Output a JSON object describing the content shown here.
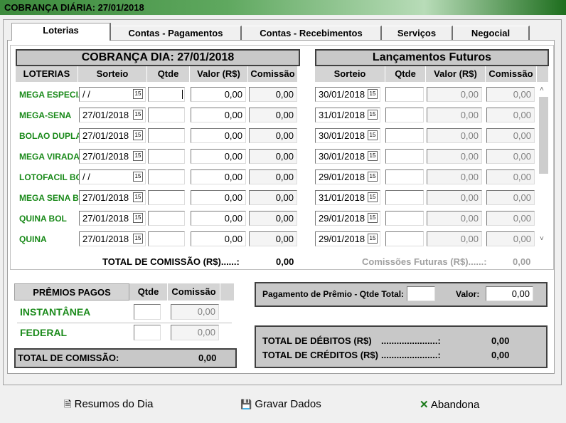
{
  "title": "COBRANÇA DIÁRIA: 27/01/2018",
  "tabs": [
    "Loterias",
    "Contas - Pagamentos",
    "Contas - Recebimentos",
    "Serviços",
    "Negocial"
  ],
  "left": {
    "title": "COBRANÇA DIA: 27/01/2018",
    "headers": [
      "LOTERIAS",
      "Sorteio",
      "Qtde",
      "Valor (R$)",
      "Comissão"
    ]
  },
  "right": {
    "title": "Lançamentos Futuros",
    "headers": [
      "Sorteio",
      "Qtde",
      "Valor (R$)",
      "Comissão"
    ]
  },
  "rows": [
    {
      "name": "MEGA  ESPECIAL",
      "sorteio": " /  /",
      "valor": "0,00",
      "comissao": "0,00",
      "fsorteio": "30/01/2018",
      "fvalor": "0,00",
      "fcomissao": "0,00"
    },
    {
      "name": "MEGA-SENA",
      "sorteio": "27/01/2018",
      "valor": "0,00",
      "comissao": "0,00",
      "fsorteio": "31/01/2018",
      "fvalor": "0,00",
      "fcomissao": "0,00"
    },
    {
      "name": "BOLAO DUPLA SENA",
      "sorteio": "27/01/2018",
      "valor": "0,00",
      "comissao": "0,00",
      "fsorteio": "30/01/2018",
      "fvalor": "0,00",
      "fcomissao": "0,00"
    },
    {
      "name": "MEGA VIRADA BOLAO",
      "sorteio": "27/01/2018",
      "valor": "0,00",
      "comissao": "0,00",
      "fsorteio": "30/01/2018",
      "fvalor": "0,00",
      "fcomissao": "0,00"
    },
    {
      "name": "LOTOFACIL BOLAO",
      "sorteio": " /  /",
      "valor": "0,00",
      "comissao": "0,00",
      "fsorteio": "29/01/2018",
      "fvalor": "0,00",
      "fcomissao": "0,00"
    },
    {
      "name": "MEGA SENA BOLAO",
      "sorteio": "27/01/2018",
      "valor": "0,00",
      "comissao": "0,00",
      "fsorteio": "31/01/2018",
      "fvalor": "0,00",
      "fcomissao": "0,00"
    },
    {
      "name": "QUINA BOL",
      "sorteio": "27/01/2018",
      "valor": "0,00",
      "comissao": "0,00",
      "fsorteio": "29/01/2018",
      "fvalor": "0,00",
      "fcomissao": "0,00"
    },
    {
      "name": "QUINA",
      "sorteio": "27/01/2018",
      "valor": "0,00",
      "comissao": "0,00",
      "fsorteio": "29/01/2018",
      "fvalor": "0,00",
      "fcomissao": "0,00"
    }
  ],
  "total_comissao_label": "TOTAL DE COMISSÃO (R$)......:",
  "total_comissao_value": "0,00",
  "comissoes_futuras_label": "Comissões Futuras (R$)......:",
  "comissoes_futuras_value": "0,00",
  "premios": {
    "headers": [
      "PRÊMIOS PAGOS",
      "Qtde",
      "Comissão"
    ],
    "rows": [
      {
        "name": "INSTANTÂNEA",
        "comissao": "0,00"
      },
      {
        "name": "FEDERAL",
        "comissao": "0,00"
      }
    ],
    "total_label": "TOTAL DE COMISSÃO:",
    "total_value": "0,00"
  },
  "pagamento": {
    "label": "Pagamento de Prêmio - Qtde Total:",
    "valor_label": "Valor:",
    "valor": "0,00"
  },
  "totais": {
    "debitos_label": "TOTAL DE DÉBITOS (R$)",
    "debitos_dots": "......................:",
    "debitos": "0,00",
    "creditos_label": "TOTAL DE CRÉDITOS (R$)",
    "creditos_dots": "......................:",
    "creditos": "0,00"
  },
  "buttons": {
    "resumos": "Resumos do Dia",
    "gravar": "Gravar Dados",
    "abandona": "Abandona"
  },
  "calendar_glyph": "15",
  "colors": {
    "green": "#1a8a1a",
    "title_green": "#3c8a3c"
  }
}
